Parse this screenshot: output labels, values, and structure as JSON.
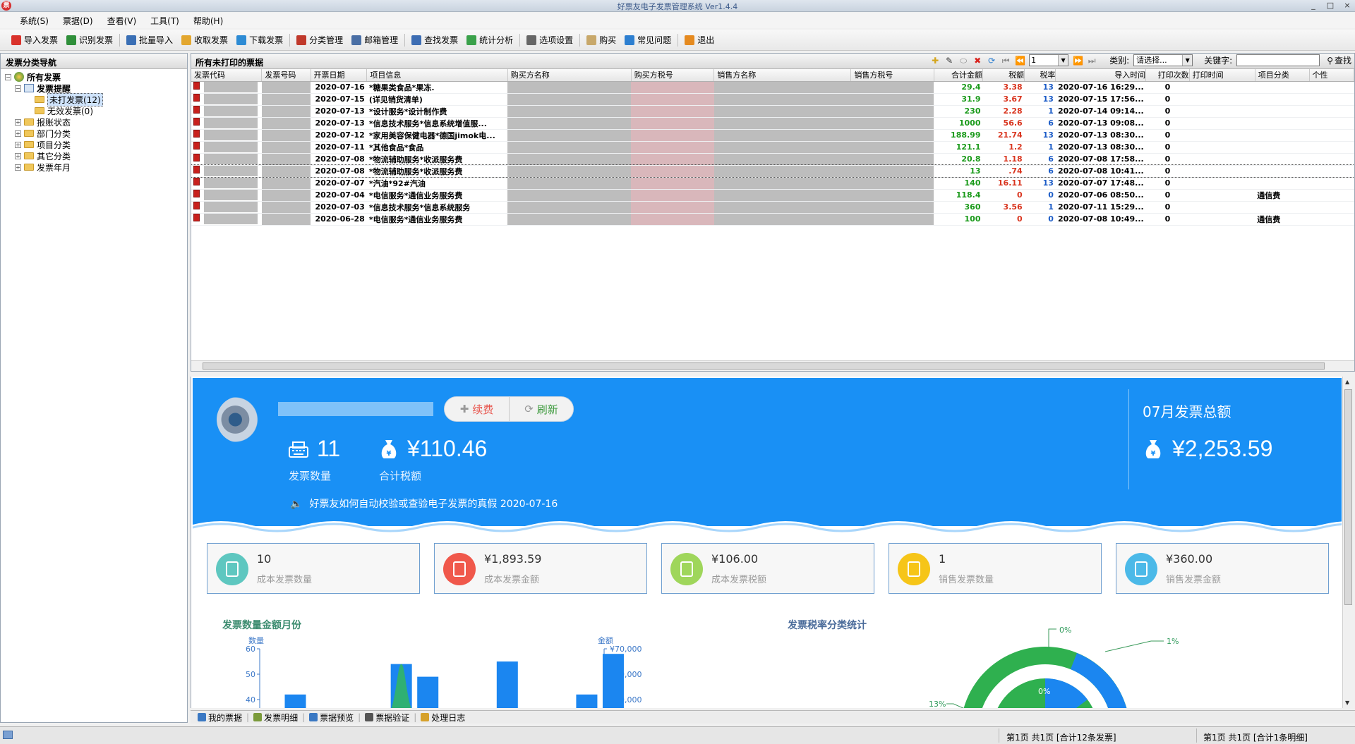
{
  "window": {
    "title": "好票友电子发票管理系统 Ver1.4.4",
    "controls": [
      "_",
      "□",
      "×"
    ]
  },
  "menu": [
    "系统(S)",
    "票据(D)",
    "查看(V)",
    "工具(T)",
    "帮助(H)"
  ],
  "toolbar": [
    {
      "label": "导入发票",
      "icon": "import-invoice-icon",
      "color": "#d9322b"
    },
    {
      "label": "识别发票",
      "icon": "recognize-invoice-icon",
      "color": "#2f8f3a"
    },
    {
      "label": "批量导入",
      "icon": "batch-import-icon",
      "color": "#3a6fb5"
    },
    {
      "label": "收取发票",
      "icon": "receive-invoice-icon",
      "color": "#e3a72f"
    },
    {
      "label": "下载发票",
      "icon": "download-invoice-icon",
      "color": "#2d8bd4"
    },
    {
      "label": "分类管理",
      "icon": "category-manage-icon",
      "color": "#c0392b"
    },
    {
      "label": "邮箱管理",
      "icon": "mailbox-manage-icon",
      "color": "#4a6fa5"
    },
    {
      "label": "查找发票",
      "icon": "find-invoice-icon",
      "color": "#3d6db3"
    },
    {
      "label": "统计分析",
      "icon": "statistics-icon",
      "color": "#3aa14a"
    },
    {
      "label": "选项设置",
      "icon": "settings-icon",
      "color": "#666666"
    },
    {
      "label": "购买",
      "icon": "buy-icon",
      "color": "#c8a86a"
    },
    {
      "label": "常见问题",
      "icon": "faq-icon",
      "color": "#2d7fd0"
    },
    {
      "label": "退出",
      "icon": "exit-icon",
      "color": "#e58a1f"
    }
  ],
  "nav": {
    "header": "发票分类导航",
    "root": "所有发票",
    "reminder": "发票提醒",
    "unprinted": "未打发票(12)",
    "invalid": "无效发票(0)",
    "groups": [
      "报账状态",
      "部门分类",
      "项目分类",
      "其它分类",
      "发票年月"
    ]
  },
  "main": {
    "title": "所有未打印的票据",
    "page_value": "1",
    "category_label": "类别:",
    "category_value": "请选择...",
    "keyword_label": "关键字:",
    "search_label": "查找",
    "columns": [
      "发票代码",
      "发票号码",
      "开票日期",
      "项目信息",
      "购买方名称",
      "购买方税号",
      "销售方名称",
      "销售方税号",
      "合计金额",
      "税额",
      "税率",
      "导入时间",
      "打印次数",
      "打印时间",
      "项目分类",
      "个性"
    ],
    "rows": [
      {
        "date": "2020-07-16",
        "item": "*糖果类食品*果冻.",
        "total": "29.4",
        "tax": "3.38",
        "rate": "13",
        "imported": "2020-07-16 16:29...",
        "prints": "0",
        "category": ""
      },
      {
        "date": "2020-07-15",
        "item": "(详见销货清单)",
        "total": "31.9",
        "tax": "3.67",
        "rate": "13",
        "imported": "2020-07-15 17:56...",
        "prints": "0",
        "category": ""
      },
      {
        "date": "2020-07-13",
        "item": "*设计服务*设计制作费",
        "total": "230",
        "tax": "2.28",
        "rate": "1",
        "imported": "2020-07-14 09:14...",
        "prints": "0",
        "category": ""
      },
      {
        "date": "2020-07-13",
        "item": "*信息技术服务*信息系统增值服...",
        "total": "1000",
        "tax": "56.6",
        "rate": "6",
        "imported": "2020-07-13 09:08...",
        "prints": "0",
        "category": ""
      },
      {
        "date": "2020-07-12",
        "item": "*家用美容保健电器*德国jimok电...",
        "total": "188.99",
        "tax": "21.74",
        "rate": "13",
        "imported": "2020-07-13 08:30...",
        "prints": "0",
        "category": ""
      },
      {
        "date": "2020-07-11",
        "item": "*其他食品*食品",
        "total": "121.1",
        "tax": "1.2",
        "rate": "1",
        "imported": "2020-07-13 08:30...",
        "prints": "0",
        "category": ""
      },
      {
        "date": "2020-07-08",
        "item": "*物流辅助服务*收派服务费",
        "total": "20.8",
        "tax": "1.18",
        "rate": "6",
        "imported": "2020-07-08 17:58...",
        "prints": "0",
        "category": ""
      },
      {
        "date": "2020-07-08",
        "item": "*物流辅助服务*收派服务费",
        "total": "13",
        "tax": ".74",
        "rate": "6",
        "imported": "2020-07-08 10:41...",
        "prints": "0",
        "category": ""
      },
      {
        "date": "2020-07-07",
        "item": "*汽油*92#汽油",
        "total": "140",
        "tax": "16.11",
        "rate": "13",
        "imported": "2020-07-07 17:48...",
        "prints": "0",
        "category": ""
      },
      {
        "date": "2020-07-04",
        "item": "*电信服务*通信业务服务费",
        "total": "118.4",
        "tax": "0",
        "rate": "0",
        "imported": "2020-07-06 08:50...",
        "prints": "0",
        "category": "通信费"
      },
      {
        "date": "2020-07-03",
        "item": "*信息技术服务*信息系统服务",
        "total": "360",
        "tax": "3.56",
        "rate": "1",
        "imported": "2020-07-11 15:29...",
        "prints": "0",
        "category": ""
      },
      {
        "date": "2020-06-28",
        "item": "*电信服务*通信业务服务费",
        "total": "100",
        "tax": "0",
        "rate": "0",
        "imported": "2020-07-08 10:49...",
        "prints": "0",
        "category": "通信费"
      }
    ]
  },
  "dashboard": {
    "renew_label": "续费",
    "refresh_label": "刷新",
    "invoice_count": "11",
    "invoice_count_label": "发票数量",
    "tax_total": "¥110.46",
    "tax_total_label": "合计税额",
    "notice": "好票友如何自动校验或查验电子发票的真假 2020-07-16",
    "month_title": "07月发票总额",
    "month_total": "¥2,253.59",
    "accent": "#1990f5",
    "cards": [
      {
        "value": "10",
        "label": "成本发票数量",
        "color": "#5ec7c0",
        "icon": "clipboard-check-icon"
      },
      {
        "value": "¥1,893.59",
        "label": "成本发票金额",
        "color": "#f0584b",
        "icon": "ledger-book-icon"
      },
      {
        "value": "¥106.00",
        "label": "成本发票税额",
        "color": "#9fd65b",
        "icon": "document-icon"
      },
      {
        "value": "1",
        "label": "销售发票数量",
        "color": "#f6c518",
        "icon": "briefcase-icon"
      },
      {
        "value": "¥360.00",
        "label": "销售发票金额",
        "color": "#4bb9e8",
        "icon": "invoice-check-icon"
      }
    ]
  },
  "chart_data": [
    {
      "type": "bar",
      "title": "发票数量金额月份",
      "ylabel": "数量",
      "y2label": "金额",
      "y_ticks": [
        "60",
        "50",
        "40"
      ],
      "y2_ticks": [
        "¥70,000",
        "¥60,000",
        "¥50,000"
      ],
      "ylim": [
        40,
        60
      ],
      "y2lim": [
        50000,
        70000
      ],
      "series": [
        {
          "values": [
            42,
            0,
            0,
            0,
            54,
            49,
            0,
            0,
            55,
            0,
            0,
            42,
            58
          ]
        }
      ],
      "color": "#1b86f0",
      "area_color": "#2fb073",
      "legend_position": "none"
    },
    {
      "type": "pie",
      "title": "发票税率分类统计",
      "labels": [
        "0%",
        "1%",
        "13%",
        "0%"
      ],
      "colors": [
        "#2fb04f",
        "#1b86f0"
      ]
    }
  ],
  "bottom_tabs": [
    "我的票据",
    "发票明细",
    "票据预览",
    "票据验证",
    "处理日志"
  ],
  "status": {
    "left_page": "第1页 共1页 [合计12条发票]",
    "right_page": "第1页 共1页 [合计1条明细]"
  }
}
